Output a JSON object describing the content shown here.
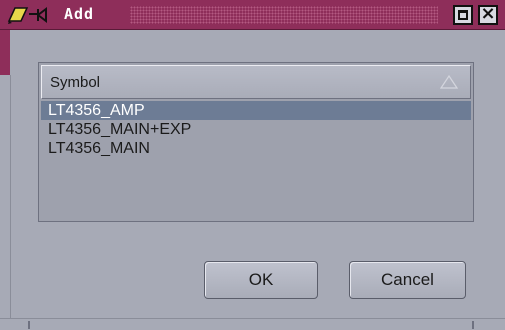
{
  "window": {
    "title": "Add"
  },
  "list": {
    "header": "Symbol",
    "rows": [
      {
        "label": "LT4356_AMP",
        "selected": true
      },
      {
        "label": "LT4356_MAIN+EXP",
        "selected": false
      },
      {
        "label": "LT4356_MAIN",
        "selected": false
      }
    ]
  },
  "buttons": {
    "ok_label": "OK",
    "cancel_label": "Cancel"
  },
  "icons": {
    "app": "edit-pencil-icon",
    "maximize": "maximize-icon",
    "close": "close-icon",
    "sort": "sort-ascending-icon"
  },
  "colors": {
    "titlebar": "#8e2e5a",
    "background": "#a7aab6",
    "selection": "#6d7c95"
  }
}
